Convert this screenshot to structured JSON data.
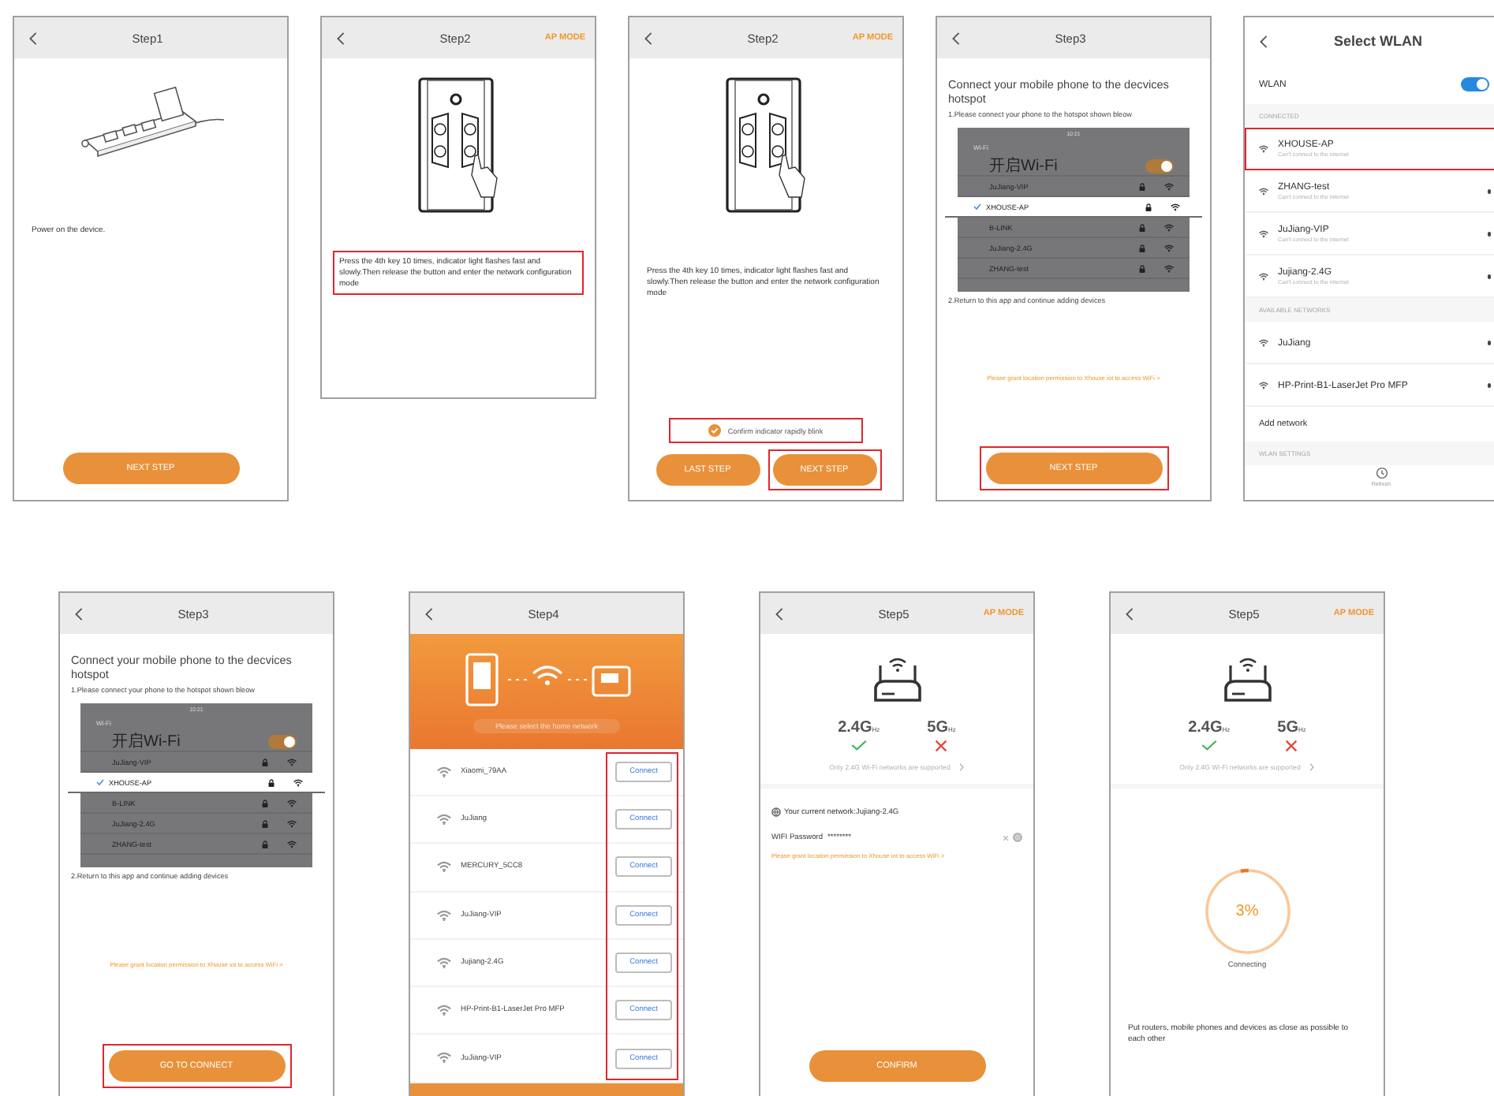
{
  "rows": [
    {
      "screens": [
        {
          "kind": "step",
          "cropped": false,
          "title": "Step1",
          "blocks": [
            {
              "kind": "power-strip"
            },
            {
              "kind": "text",
              "text": "Power on the device.",
              "highlighted": false
            },
            {
              "kind": "button",
              "label": "NEXT STEP",
              "highlighted": false
            }
          ]
        },
        {
          "kind": "step",
          "cropped": true,
          "title": "Step2",
          "action": "AP MODE",
          "blocks": [
            {
              "kind": "switch-panel"
            },
            {
              "kind": "text",
              "text": "Press the 4th key 10 times, indicator light flashes fast and slowly.Then release the button and enter the network configuration mode",
              "highlighted": true
            }
          ]
        },
        {
          "kind": "step",
          "cropped": false,
          "title": "Step2",
          "action": "AP MODE",
          "blocks": [
            {
              "kind": "switch-panel"
            },
            {
              "kind": "text",
              "text": "Press the 4th key 10 times, indicator light flashes fast and slowly.Then release the button and enter the network configuration mode",
              "highlighted": false
            },
            {
              "kind": "check",
              "label": "Confirm indicator rapidly blink",
              "checked": true,
              "highlighted": true
            },
            {
              "kind": "button-row",
              "buttons": [
                {
                  "label": "LAST STEP",
                  "highlighted": false
                },
                {
                  "label": "NEXT STEP",
                  "highlighted": true
                }
              ]
            }
          ]
        },
        {
          "kind": "step",
          "cropped": false,
          "title": "Step3",
          "blocks": [
            {
              "kind": "heading",
              "text": "Connect your mobile phone to the decvices hotspot"
            },
            {
              "kind": "note",
              "text": "1.Please connect your phone to the hotspot shown bleow"
            },
            {
              "kind": "wifi-mock",
              "time": "10:21",
              "title": "Wi-Fi",
              "toggle_label": "开启Wi-Fi",
              "toggle_on": true,
              "networks": [
                {
                  "name": "JuJiang-VIP",
                  "selected": false
                },
                {
                  "name": "XHOUSE-AP",
                  "selected": true
                },
                {
                  "name": "B-LINK",
                  "selected": false
                },
                {
                  "name": "JuJiang-2.4G",
                  "selected": false
                },
                {
                  "name": "ZHANG-test",
                  "selected": false
                }
              ]
            },
            {
              "kind": "note",
              "text": "2.Return to this app and continue adding devices"
            },
            {
              "kind": "warning",
              "text": "Please grant location permission to Xhouse iot to access WiFi >"
            },
            {
              "kind": "button",
              "label": "NEXT STEP",
              "highlighted": true
            }
          ]
        },
        {
          "kind": "settings",
          "cropped": false,
          "title": "Select WLAN",
          "blocks": [
            {
              "kind": "switch-row",
              "label": "WLAN",
              "on": true
            },
            {
              "kind": "section",
              "text": "CONNECTED"
            },
            {
              "kind": "network",
              "name": "XHOUSE-AP",
              "status": "Can't connect to the internet",
              "secured": false,
              "highlighted": true
            },
            {
              "kind": "network",
              "name": "ZHANG-test",
              "status": "Can't connect to the internet",
              "secured": true,
              "highlighted": false
            },
            {
              "kind": "network",
              "name": "JuJiang-VIP",
              "status": "Can't connect to the internet",
              "secured": true,
              "highlighted": false
            },
            {
              "kind": "network",
              "name": "Jujiang-2.4G",
              "status": "Can't connect to the internet",
              "secured": true,
              "highlighted": false
            },
            {
              "kind": "section",
              "text": "AVAILABLE NETWORKS"
            },
            {
              "kind": "network",
              "name": "JuJiang",
              "secured": true,
              "highlighted": false
            },
            {
              "kind": "network",
              "name": "HP-Print-B1-LaserJet Pro MFP",
              "secured": true,
              "highlighted": false
            },
            {
              "kind": "row",
              "text": "Add network"
            },
            {
              "kind": "section",
              "text": "WLAN SETTINGS"
            },
            {
              "kind": "refresh",
              "label": "Refresh"
            }
          ]
        }
      ]
    },
    {
      "screens": [
        {
          "kind": "step",
          "cropped": false,
          "title": "Step3",
          "blocks": [
            {
              "kind": "heading",
              "text": "Connect your mobile phone to the decvices hotspot"
            },
            {
              "kind": "note",
              "text": "1.Please connect your phone to the hotspot shown bleow"
            },
            {
              "kind": "wifi-mock",
              "time": "10:21",
              "title": "Wi-Fi",
              "toggle_label": "开启Wi-Fi",
              "toggle_on": true,
              "networks": [
                {
                  "name": "JuJiang-VIP",
                  "selected": false
                },
                {
                  "name": "XHOUSE-AP",
                  "selected": true
                },
                {
                  "name": "B-LINK",
                  "selected": false
                },
                {
                  "name": "JuJiang-2.4G",
                  "selected": false
                },
                {
                  "name": "ZHANG-test",
                  "selected": false
                }
              ]
            },
            {
              "kind": "note",
              "text": "2.Return to this app and continue adding devices"
            },
            {
              "kind": "warning",
              "text": "Please grant location permission to Xhouse iot to access WiFi >"
            },
            {
              "kind": "button",
              "label": "GO TO CONNECT",
              "highlighted": true
            }
          ]
        },
        {
          "kind": "step",
          "cropped": false,
          "title": "Step4",
          "blocks": [
            {
              "kind": "banner",
              "text": "Please select the home network"
            },
            {
              "kind": "connect-list",
              "highlighted": true,
              "networks": [
                {
                  "name": "Xiaomi_79AA",
                  "action": "Connect"
                },
                {
                  "name": "JuJiang",
                  "action": "Connect"
                },
                {
                  "name": "MERCURY_5CC8",
                  "action": "Connect"
                },
                {
                  "name": "JuJiang-VIP",
                  "action": "Connect"
                },
                {
                  "name": "Jujiang-2.4G",
                  "action": "Connect"
                },
                {
                  "name": "HP-Print-B1-LaserJet Pro MFP",
                  "action": "Connect"
                },
                {
                  "name": "JuJiang-VIP",
                  "action": "Connect"
                }
              ]
            },
            {
              "kind": "bottom-bar"
            }
          ]
        },
        {
          "kind": "step",
          "cropped": false,
          "title": "Step5",
          "action": "AP MODE",
          "blocks": [
            {
              "kind": "router"
            },
            {
              "kind": "bands",
              "bands": [
                {
                  "name": "2.4G",
                  "unit": "Hz",
                  "supported": true
                },
                {
                  "name": "5G",
                  "unit": "Hz",
                  "supported": false
                }
              ],
              "note": "Only 2.4G Wi-Fi networks are supported"
            },
            {
              "kind": "info",
              "text": "Your current network:Jujiang-2.4G"
            },
            {
              "kind": "password",
              "label": "WIFI Password",
              "value": "********"
            },
            {
              "kind": "warning",
              "text": "Please grant location permission to Xhouse iot to access WiFi >"
            },
            {
              "kind": "button",
              "label": "CONFIRM",
              "highlighted": false
            }
          ]
        },
        {
          "kind": "step",
          "cropped": false,
          "title": "Step5",
          "action": "AP MODE",
          "blocks": [
            {
              "kind": "router"
            },
            {
              "kind": "bands",
              "bands": [
                {
                  "name": "2.4G",
                  "unit": "Hz",
                  "supported": true
                },
                {
                  "name": "5G",
                  "unit": "Hz",
                  "supported": false
                }
              ],
              "note": "Only 2.4G Wi-Fi networks are supported"
            },
            {
              "kind": "progress",
              "level": 0.03,
              "reading": "3%",
              "label": "Connecting"
            },
            {
              "kind": "text",
              "text": "Put routers, mobile phones and devices as close as possible to each other",
              "highlighted": false
            }
          ]
        }
      ]
    }
  ]
}
